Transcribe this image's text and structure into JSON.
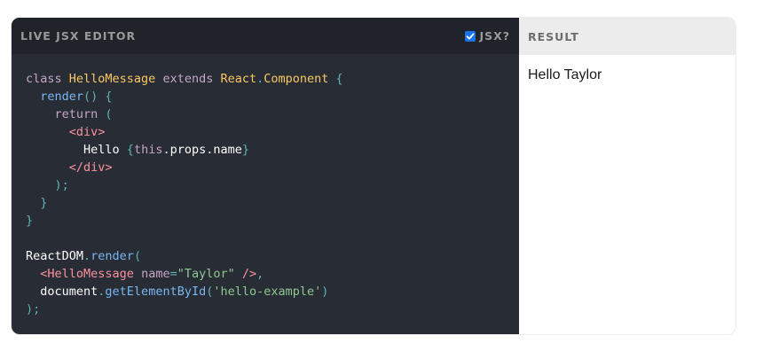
{
  "editor": {
    "title": "Live JSX Editor",
    "jsx_toggle": {
      "label": "JSX?",
      "checked": true
    },
    "code_lines": [
      [
        {
          "t": "class ",
          "k": "keyword"
        },
        {
          "t": "HelloMessage",
          "k": "class"
        },
        {
          "t": " extends ",
          "k": "keyword"
        },
        {
          "t": "React",
          "k": "class"
        },
        {
          "t": ".",
          "k": "punct"
        },
        {
          "t": "Component",
          "k": "class"
        },
        {
          "t": " {",
          "k": "punct"
        }
      ],
      [
        {
          "t": "  ",
          "k": "plain"
        },
        {
          "t": "render",
          "k": "fn"
        },
        {
          "t": "() {",
          "k": "punct"
        }
      ],
      [
        {
          "t": "    ",
          "k": "plain"
        },
        {
          "t": "return",
          "k": "keyword"
        },
        {
          "t": " (",
          "k": "punct"
        }
      ],
      [
        {
          "t": "      ",
          "k": "plain"
        },
        {
          "t": "<",
          "k": "tag"
        },
        {
          "t": "div",
          "k": "tag"
        },
        {
          "t": ">",
          "k": "tag"
        }
      ],
      [
        {
          "t": "        Hello ",
          "k": "plain"
        },
        {
          "t": "{",
          "k": "punct"
        },
        {
          "t": "this",
          "k": "keyword"
        },
        {
          "t": ".props.name",
          "k": "plain"
        },
        {
          "t": "}",
          "k": "punct"
        }
      ],
      [
        {
          "t": "      ",
          "k": "plain"
        },
        {
          "t": "</",
          "k": "tag"
        },
        {
          "t": "div",
          "k": "tag"
        },
        {
          "t": ">",
          "k": "tag"
        }
      ],
      [
        {
          "t": "    );",
          "k": "punct"
        }
      ],
      [
        {
          "t": "  }",
          "k": "punct"
        }
      ],
      [
        {
          "t": "}",
          "k": "punct"
        }
      ],
      [],
      [
        {
          "t": "ReactDOM",
          "k": "plain"
        },
        {
          "t": ".",
          "k": "punct"
        },
        {
          "t": "render",
          "k": "fn"
        },
        {
          "t": "(",
          "k": "punct"
        }
      ],
      [
        {
          "t": "  ",
          "k": "plain"
        },
        {
          "t": "<HelloMessage",
          "k": "tag"
        },
        {
          "t": " name",
          "k": "attr"
        },
        {
          "t": "=",
          "k": "punct"
        },
        {
          "t": "\"Taylor\"",
          "k": "string"
        },
        {
          "t": " />",
          "k": "tag"
        },
        {
          "t": ",",
          "k": "punct"
        }
      ],
      [
        {
          "t": "  document",
          "k": "plain"
        },
        {
          "t": ".",
          "k": "punct"
        },
        {
          "t": "getElementById",
          "k": "fn"
        },
        {
          "t": "(",
          "k": "punct"
        },
        {
          "t": "'hello-example'",
          "k": "string"
        },
        {
          "t": ")",
          "k": "punct"
        }
      ],
      [
        {
          "t": ");",
          "k": "punct"
        }
      ]
    ]
  },
  "result": {
    "title": "Result",
    "output_text": "Hello Taylor"
  },
  "colors": {
    "editor_bg": "#282c34",
    "editor_header_bg": "#20232a",
    "result_header_bg": "#ececec",
    "checkbox_accent": "#1a73e8"
  },
  "icons": {
    "checkbox": "checkmark-icon"
  }
}
